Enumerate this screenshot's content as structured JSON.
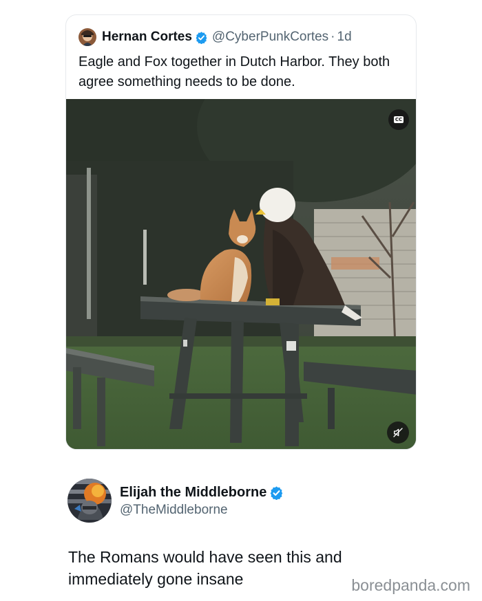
{
  "quoted_tweet": {
    "author_name": "Hernan Cortes",
    "handle": "@CyberPunkCortes",
    "separator": "·",
    "timestamp": "1d",
    "text": "Eagle and Fox together in Dutch Harbor. They both agree something needs to be done.",
    "verified": true,
    "media": {
      "type": "video",
      "captions_label": "CC",
      "mute_icon": "speaker-muted-icon"
    }
  },
  "reply_tweet": {
    "author_name": "Elijah the Middleborne",
    "handle": "@TheMiddleborne",
    "verified": true,
    "text": "The Romans would have seen this and immediately gone insane"
  },
  "watermark": "boredpanda.com",
  "colors": {
    "verified_blue": "#1d9bf0",
    "secondary_text": "#536471",
    "primary_text": "#0f1419",
    "watermark": "#8a8f94"
  }
}
